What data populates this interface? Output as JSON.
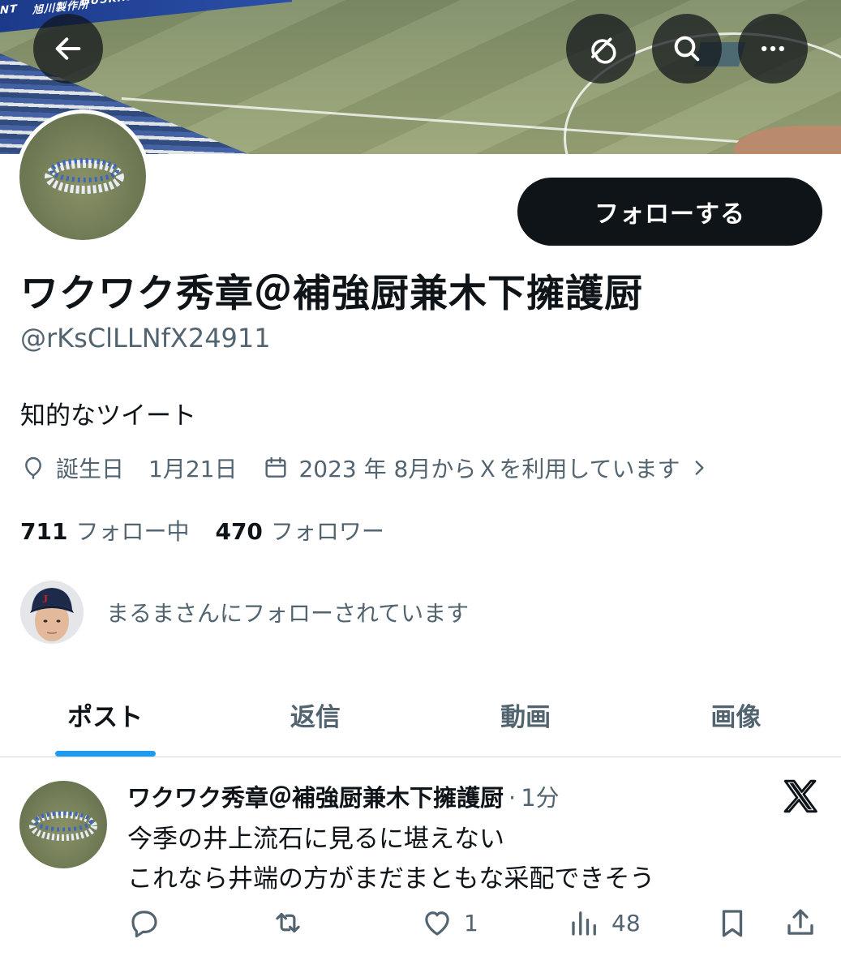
{
  "banner": {
    "wall_text_left": "旭川製作所",
    "wall_text_right": "DUSKIN",
    "wall_text_edge": "NT"
  },
  "header": {
    "back_icon": "arrow-left-icon",
    "grok_icon": "grok-icon",
    "search_icon": "search-icon",
    "more_icon": "more-horizontal-icon"
  },
  "profile": {
    "follow_label": "フォローする",
    "display_name": "ワクワク秀章＠補強厨兼木下擁護厨",
    "handle": "@rKsClLLNfX24911",
    "bio": "知的なツイート",
    "birthday_label": "誕生日",
    "birthday_value": "1月21日",
    "joined": "2023 年 8月からＸを利用しています",
    "following_count": "711",
    "following_label": "フォロー中",
    "followers_count": "470",
    "followers_label": "フォロワー",
    "followed_by_text": "まるまさんにフォローされています"
  },
  "tabs": [
    {
      "label": "ポスト",
      "active": true
    },
    {
      "label": "返信",
      "active": false
    },
    {
      "label": "動画",
      "active": false
    },
    {
      "label": "画像",
      "active": false
    }
  ],
  "post": {
    "author": "ワクワク秀章＠補強厨兼木下擁護厨",
    "separator": "·",
    "time": "1分",
    "line1": "今季の井上流石に見るに堪えない",
    "line2": "これなら井端の方がまだまともな采配できそう",
    "reply_count": "",
    "repost_count": "",
    "like_count": "1",
    "view_count": "48"
  },
  "colors": {
    "accent": "#1d9bf0",
    "text_primary": "#0f1419",
    "text_secondary": "#536471",
    "follow_button": "#0f1419"
  }
}
